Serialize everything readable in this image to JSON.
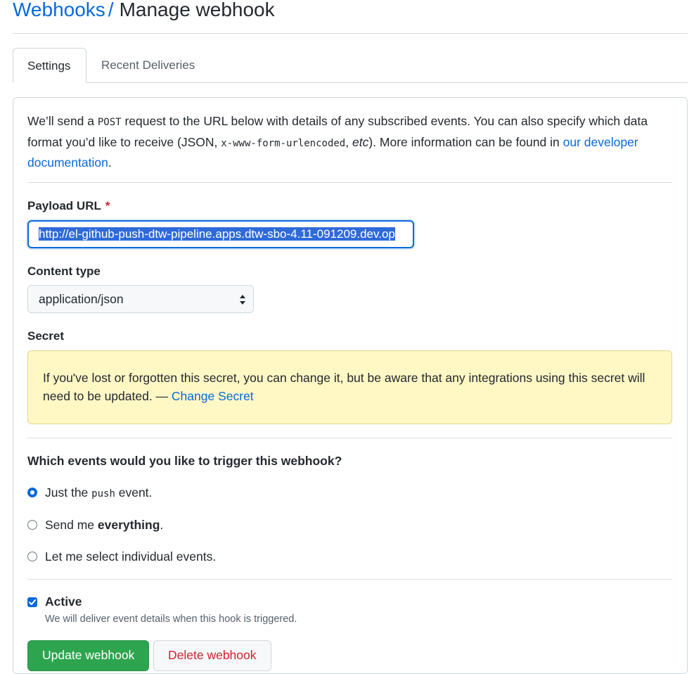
{
  "header": {
    "breadcrumb_parent": "Webhooks",
    "breadcrumb_separator": "/",
    "title": "Manage webhook"
  },
  "tabs": [
    {
      "label": "Settings",
      "selected": true
    },
    {
      "label": "Recent Deliveries",
      "selected": false
    }
  ],
  "intro": {
    "part1": "We’ll send a ",
    "method": "POST",
    "part2": " request to the URL below with details of any subscribed events. You can also specify which data format you’d like to receive (JSON, ",
    "format": "x-www-form-urlencoded",
    "part3": ", ",
    "etc": "etc",
    "part4": "). More information can be found in ",
    "link_text": "our developer documentation",
    "part5": "."
  },
  "payload_url": {
    "label": "Payload URL",
    "required_mark": "*",
    "value": "http://el-github-push-dtw-pipeline.apps.dtw-sbo-4.11-091209.dev.op"
  },
  "content_type": {
    "label": "Content type",
    "selected": "application/json"
  },
  "secret": {
    "label": "Secret",
    "notice": "If you've lost or forgotten this secret, you can change it, but be aware that any integrations using this secret will need to be updated. — ",
    "change_link": "Change Secret"
  },
  "events": {
    "question": "Which events would you like to trigger this webhook?",
    "options": [
      {
        "prefix": "Just the ",
        "code": "push",
        "suffix": " event.",
        "checked": true
      },
      {
        "prefix": "Send me ",
        "bold": "everything",
        "suffix": ".",
        "checked": false
      },
      {
        "label": "Let me select individual events.",
        "checked": false
      }
    ]
  },
  "active": {
    "label": "Active",
    "checked": true,
    "note": "We will deliver event details when this hook is triggered."
  },
  "buttons": {
    "update": "Update webhook",
    "delete": "Delete webhook"
  },
  "colors": {
    "link": "#0969da",
    "primary_button": "#2da44e",
    "danger_text": "#cf222e",
    "flash_bg": "#fff8c5"
  }
}
